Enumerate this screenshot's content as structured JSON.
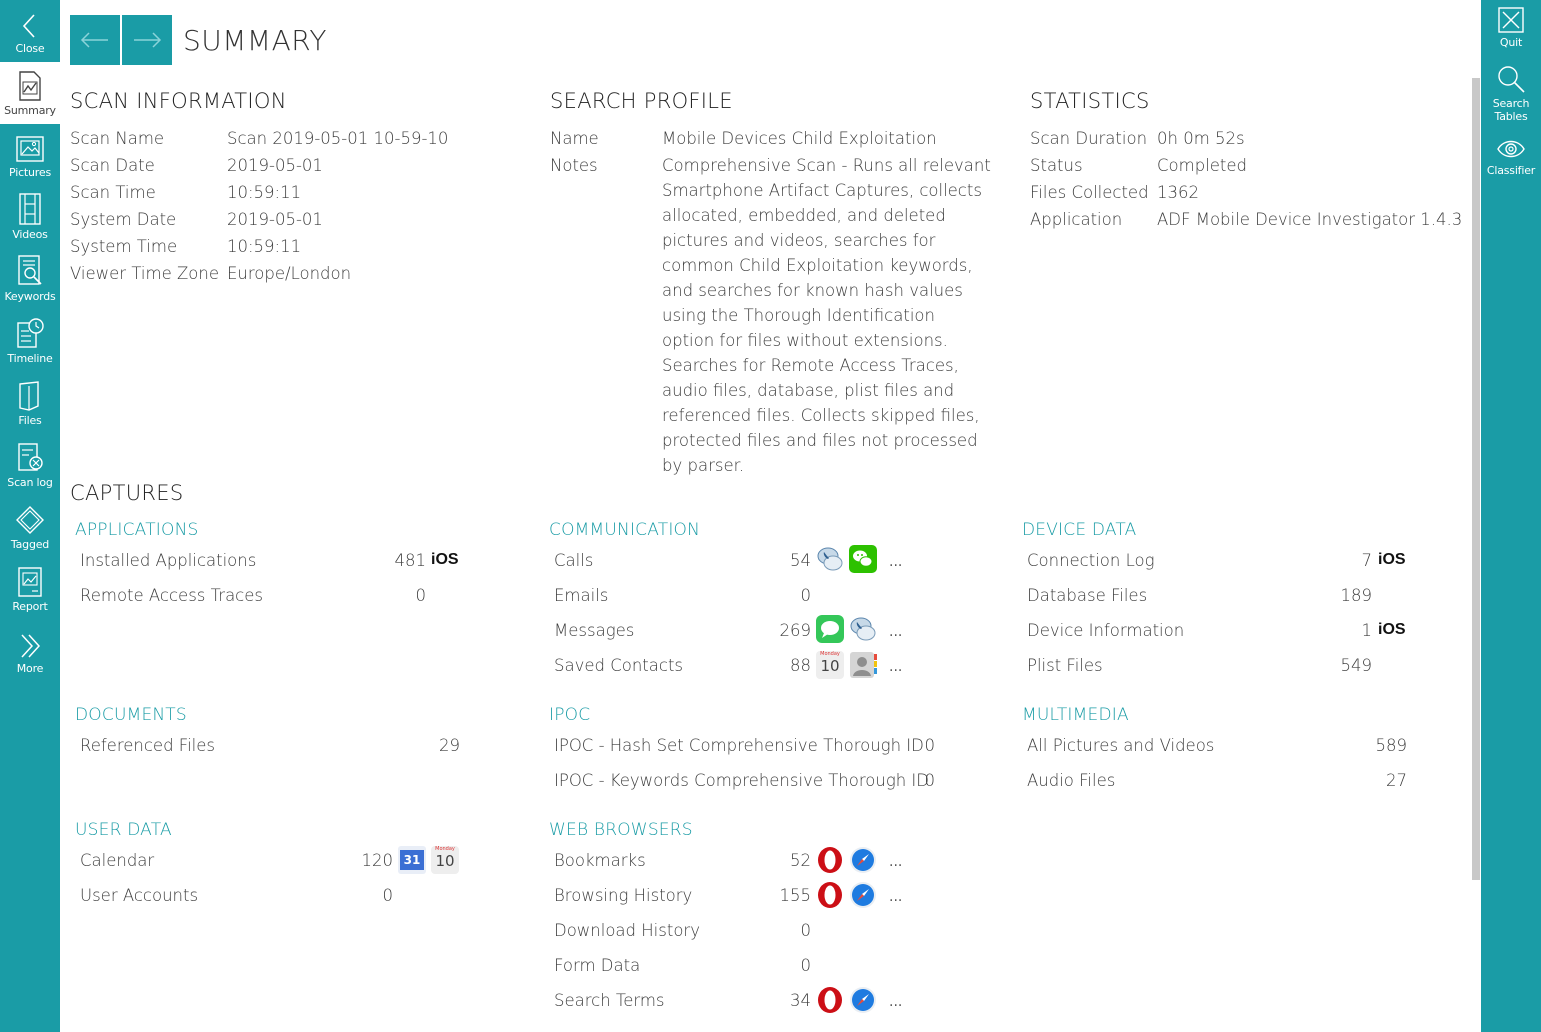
{
  "colors": {
    "accent": "#1a9ca6",
    "category": "#1a9ca6",
    "opera_red": "#cc0f16",
    "safari_blue": "#1e7be0",
    "wechat_green": "#2dc100",
    "messages_green": "#34c759"
  },
  "left_nav": [
    {
      "label": "Close",
      "icon": "chevron-left-icon"
    },
    {
      "label": "Summary",
      "icon": "summary-icon"
    },
    {
      "label": "Pictures",
      "icon": "picture-icon"
    },
    {
      "label": "Videos",
      "icon": "film-icon"
    },
    {
      "label": "Keywords",
      "icon": "keyword-search-icon"
    },
    {
      "label": "Timeline",
      "icon": "timeline-icon"
    },
    {
      "label": "Files",
      "icon": "file-icon"
    },
    {
      "label": "Scan log",
      "icon": "scan-log-icon"
    },
    {
      "label": "Tagged",
      "icon": "tag-icon"
    },
    {
      "label": "Report",
      "icon": "report-icon"
    },
    {
      "label": "More",
      "icon": "double-chevron-right-icon"
    }
  ],
  "right_nav": [
    {
      "label": "Quit",
      "icon": "close-icon"
    },
    {
      "label": "Search Tables",
      "icon": "search-icon"
    },
    {
      "label": "Classifier",
      "icon": "eye-icon"
    }
  ],
  "header": {
    "title": "SUMMARY"
  },
  "scan_information": {
    "title": "SCAN INFORMATION",
    "rows": [
      {
        "label": "Scan Name",
        "value": "Scan 2019-05-01 10-59-10"
      },
      {
        "label": "Scan Date",
        "value": "2019-05-01"
      },
      {
        "label": "Scan Time",
        "value": "10:59:11"
      },
      {
        "label": "System Date",
        "value": "2019-05-01"
      },
      {
        "label": "System Time",
        "value": "10:59:11"
      },
      {
        "label": "Viewer Time Zone",
        "value": "Europe/London"
      }
    ]
  },
  "search_profile": {
    "title": "SEARCH PROFILE",
    "name_label": "Name",
    "name_value": "Mobile Devices Child Exploitation",
    "notes_label": "Notes",
    "notes_value": "Comprehensive Scan - Runs all relevant Smartphone Artifact Captures, collects allocated, embedded, and deleted pictures and videos, searches for common Child Exploitation keywords, and searches for known hash values using the Thorough Identification option for files without extensions. Searches for Remote Access Traces, audio files, database, plist files and referenced files. Collects skipped files, protected files and files not processed by parser."
  },
  "statistics": {
    "title": "STATISTICS",
    "rows": [
      {
        "label": "Scan Duration",
        "value": "0h 0m 52s"
      },
      {
        "label": "Status",
        "value": "Completed"
      },
      {
        "label": "Files Collected",
        "value": "1362"
      },
      {
        "label": "Application",
        "value": "ADF Mobile Device Investigator 1.4.3"
      }
    ]
  },
  "captures": {
    "title": "CAPTURES",
    "ios_text": "iOS",
    "more_text": "...",
    "calendar_day": "10",
    "calendar_month": "Monday",
    "gcal_day": "31",
    "applications": {
      "title": "APPLICATIONS",
      "rows": [
        {
          "label": "Installed Applications",
          "count": "481"
        },
        {
          "label": "Remote Access Traces",
          "count": "0"
        }
      ]
    },
    "communication": {
      "title": "COMMUNICATION",
      "rows": [
        {
          "label": "Calls",
          "count": "54"
        },
        {
          "label": "Emails",
          "count": "0"
        },
        {
          "label": "Messages",
          "count": "269"
        },
        {
          "label": "Saved Contacts",
          "count": "88"
        }
      ]
    },
    "device_data": {
      "title": "DEVICE DATA",
      "rows": [
        {
          "label": "Connection Log",
          "count": "7"
        },
        {
          "label": "Database Files",
          "count": "189"
        },
        {
          "label": "Device Information",
          "count": "1"
        },
        {
          "label": "Plist Files",
          "count": "549"
        }
      ]
    },
    "documents": {
      "title": "DOCUMENTS",
      "rows": [
        {
          "label": "Referenced Files",
          "count": "29"
        }
      ]
    },
    "ipoc": {
      "title": "IPOC",
      "rows": [
        {
          "label": "IPOC - Hash Set Comprehensive Thorough ID",
          "count": "0"
        },
        {
          "label": "IPOC - Keywords Comprehensive Thorough ID",
          "count": "0"
        }
      ]
    },
    "multimedia": {
      "title": "MULTIMEDIA",
      "rows": [
        {
          "label": "All Pictures and Videos",
          "count": "589"
        },
        {
          "label": "Audio Files",
          "count": "27"
        }
      ]
    },
    "user_data": {
      "title": "USER DATA",
      "rows": [
        {
          "label": "Calendar",
          "count": "120"
        },
        {
          "label": "User Accounts",
          "count": "0"
        }
      ]
    },
    "web_browsers": {
      "title": "WEB BROWSERS",
      "rows": [
        {
          "label": "Bookmarks",
          "count": "52"
        },
        {
          "label": "Browsing History",
          "count": "155"
        },
        {
          "label": "Download History",
          "count": "0"
        },
        {
          "label": "Form Data",
          "count": "0"
        },
        {
          "label": "Search Terms",
          "count": "34"
        }
      ]
    }
  }
}
